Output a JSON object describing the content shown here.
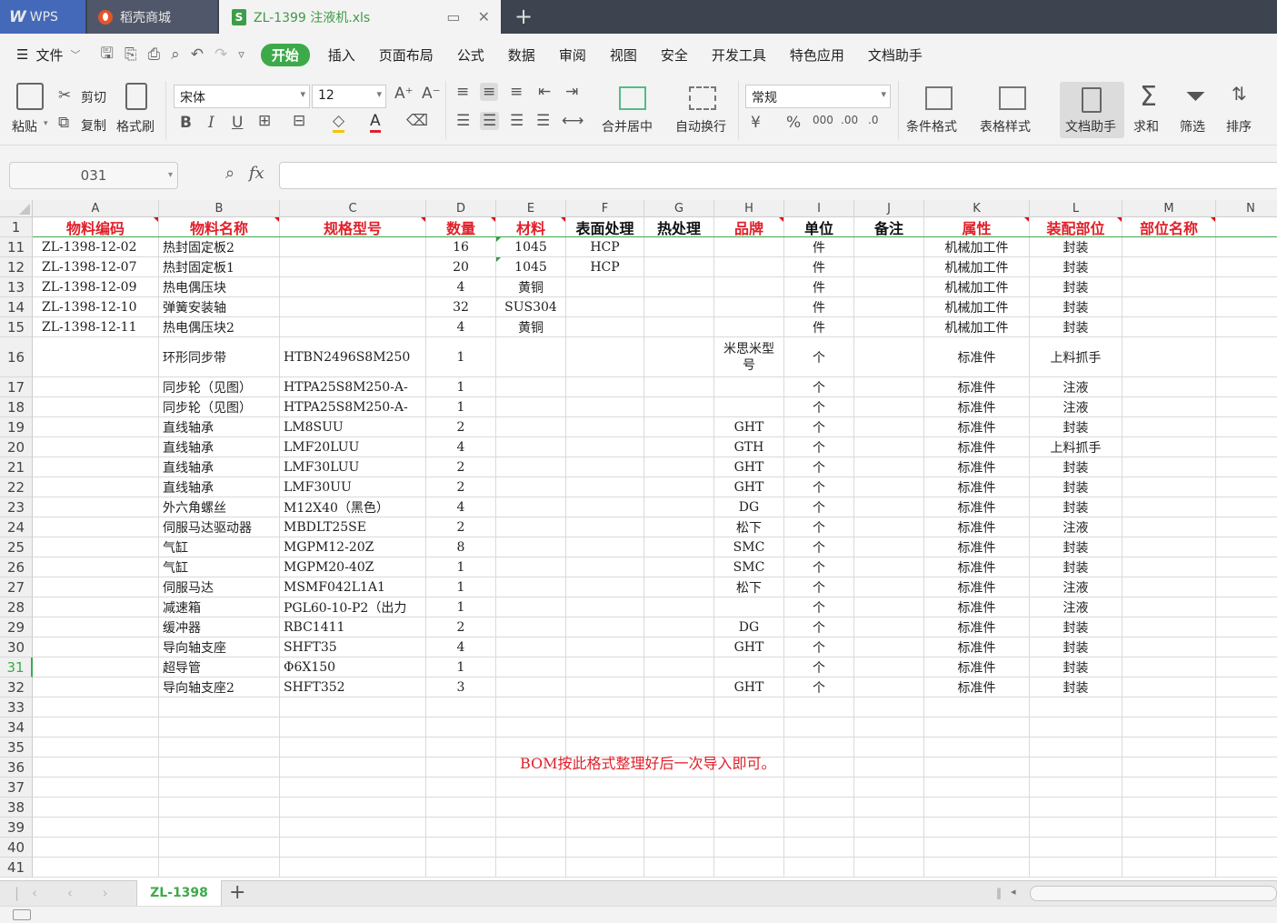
{
  "titlebar": {
    "wps_label": "WPS",
    "store_label": "稻壳商城",
    "file_title": "ZL-1399 注液机.xls",
    "file_icon_letter": "S",
    "new_tab": "+"
  },
  "menubar": {
    "file_menu": "文件",
    "items": [
      "开始",
      "插入",
      "页面布局",
      "公式",
      "数据",
      "审阅",
      "视图",
      "安全",
      "开发工具",
      "特色应用",
      "文档助手"
    ],
    "active": "开始"
  },
  "ribbon": {
    "paste": "粘贴",
    "cut": "剪切",
    "copy": "复制",
    "format_painter": "格式刷",
    "font_name": "宋体",
    "font_size": "12",
    "merge_center": "合并居中",
    "auto_wrap": "自动换行",
    "number_format": "常规",
    "conditional_format": "条件格式",
    "table_style": "表格样式",
    "doc_assistant": "文档助手",
    "sum": "求和",
    "filter": "筛选",
    "sort": "排序"
  },
  "formula_bar": {
    "name_box": "031",
    "fx": "fx",
    "content": ""
  },
  "columns": [
    "A",
    "B",
    "C",
    "D",
    "E",
    "F",
    "G",
    "H",
    "I",
    "J",
    "K",
    "L",
    "M",
    "N"
  ],
  "header_row": {
    "row_num": "1",
    "cells": [
      "物料编码",
      "物料名称",
      "规格型号",
      "数量",
      "材料",
      "表面处理",
      "热处理",
      "品牌",
      "单位",
      "备注",
      "属性",
      "装配部位",
      "部位名称",
      ""
    ]
  },
  "rows": [
    {
      "num": "11",
      "cells": [
        "ZL-1398-12-02",
        "热封固定板2",
        "",
        "16",
        "1045",
        "HCP",
        "",
        "",
        "件",
        "",
        "机械加工件",
        "封装",
        ""
      ]
    },
    {
      "num": "12",
      "cells": [
        "ZL-1398-12-07",
        "热封固定板1",
        "",
        "20",
        "1045",
        "HCP",
        "",
        "",
        "件",
        "",
        "机械加工件",
        "封装",
        ""
      ]
    },
    {
      "num": "13",
      "cells": [
        "ZL-1398-12-09",
        "热电偶压块",
        "",
        "4",
        "黄铜",
        "",
        "",
        "",
        "件",
        "",
        "机械加工件",
        "封装",
        ""
      ]
    },
    {
      "num": "14",
      "cells": [
        "ZL-1398-12-10",
        "弹簧安装轴",
        "",
        "32",
        "SUS304",
        "",
        "",
        "",
        "件",
        "",
        "机械加工件",
        "封装",
        ""
      ]
    },
    {
      "num": "15",
      "cells": [
        "ZL-1398-12-11",
        "热电偶压块2",
        "",
        "4",
        "黄铜",
        "",
        "",
        "",
        "件",
        "",
        "机械加工件",
        "封装",
        ""
      ]
    },
    {
      "num": "16",
      "cells": [
        "",
        "环形同步带",
        "HTBN2496S8M250",
        "1",
        "",
        "",
        "",
        "米思米型号",
        "个",
        "",
        "标准件",
        "上料抓手",
        ""
      ]
    },
    {
      "num": "17",
      "cells": [
        "",
        "同步轮（见图）",
        "HTPA25S8M250-A-",
        "1",
        "",
        "",
        "",
        "",
        "个",
        "",
        "标准件",
        "注液",
        ""
      ]
    },
    {
      "num": "18",
      "cells": [
        "",
        "同步轮（见图）",
        "HTPA25S8M250-A-",
        "1",
        "",
        "",
        "",
        "",
        "个",
        "",
        "标准件",
        "注液",
        ""
      ]
    },
    {
      "num": "19",
      "cells": [
        "",
        "直线轴承",
        "LM8SUU",
        "2",
        "",
        "",
        "",
        "GHT",
        "个",
        "",
        "标准件",
        "封装",
        ""
      ]
    },
    {
      "num": "20",
      "cells": [
        "",
        "直线轴承",
        "LMF20LUU",
        "4",
        "",
        "",
        "",
        "GTH",
        "个",
        "",
        "标准件",
        "上料抓手",
        ""
      ]
    },
    {
      "num": "21",
      "cells": [
        "",
        "直线轴承",
        "LMF30LUU",
        "2",
        "",
        "",
        "",
        "GHT",
        "个",
        "",
        "标准件",
        "封装",
        ""
      ]
    },
    {
      "num": "22",
      "cells": [
        "",
        "直线轴承",
        "LMF30UU",
        "2",
        "",
        "",
        "",
        "GHT",
        "个",
        "",
        "标准件",
        "封装",
        ""
      ]
    },
    {
      "num": "23",
      "cells": [
        "",
        "外六角螺丝",
        "M12X40（黑色）",
        "4",
        "",
        "",
        "",
        "DG",
        "个",
        "",
        "标准件",
        "封装",
        ""
      ]
    },
    {
      "num": "24",
      "cells": [
        "",
        "伺服马达驱动器",
        "MBDLT25SE",
        "2",
        "",
        "",
        "",
        "松下",
        "个",
        "",
        "标准件",
        "注液",
        ""
      ]
    },
    {
      "num": "25",
      "cells": [
        "",
        "气缸",
        "MGPM12-20Z",
        "8",
        "",
        "",
        "",
        "SMC",
        "个",
        "",
        "标准件",
        "封装",
        ""
      ]
    },
    {
      "num": "26",
      "cells": [
        "",
        "气缸",
        "MGPM20-40Z",
        "1",
        "",
        "",
        "",
        "SMC",
        "个",
        "",
        "标准件",
        "封装",
        ""
      ]
    },
    {
      "num": "27",
      "cells": [
        "",
        "伺服马达",
        "MSMF042L1A1",
        "1",
        "",
        "",
        "",
        "松下",
        "个",
        "",
        "标准件",
        "注液",
        ""
      ]
    },
    {
      "num": "28",
      "cells": [
        "",
        "减速箱",
        "PGL60-10-P2（出力",
        "1",
        "",
        "",
        "",
        "",
        "个",
        "",
        "标准件",
        "注液",
        ""
      ]
    },
    {
      "num": "29",
      "cells": [
        "",
        "缓冲器",
        "RBC1411",
        "2",
        "",
        "",
        "",
        "DG",
        "个",
        "",
        "标准件",
        "封装",
        ""
      ]
    },
    {
      "num": "30",
      "cells": [
        "",
        "导向轴支座",
        "SHFT35",
        "4",
        "",
        "",
        "",
        "GHT",
        "个",
        "",
        "标准件",
        "封装",
        ""
      ]
    },
    {
      "num": "31",
      "cells": [
        "",
        "超导管",
        "Φ6X150",
        "1",
        "",
        "",
        "",
        "",
        "个",
        "",
        "标准件",
        "封装",
        ""
      ]
    },
    {
      "num": "32",
      "cells": [
        "",
        "导向轴支座2",
        "SHFT352",
        "3",
        "",
        "",
        "",
        "GHT",
        "个",
        "",
        "标准件",
        "封装",
        ""
      ]
    },
    {
      "num": "33",
      "cells": []
    },
    {
      "num": "34",
      "cells": []
    },
    {
      "num": "35",
      "cells": []
    },
    {
      "num": "36",
      "cells": []
    },
    {
      "num": "37",
      "cells": []
    },
    {
      "num": "38",
      "cells": []
    },
    {
      "num": "39",
      "cells": []
    },
    {
      "num": "40",
      "cells": []
    },
    {
      "num": "41",
      "cells": []
    }
  ],
  "selected_row": "31",
  "note": "BOM按此格式整理好后一次导入即可。",
  "sheet_tab": "ZL-1398",
  "colors": {
    "accent_green": "#3daa4a",
    "header_red": "#e0202a",
    "title_bar": "#3d4450"
  }
}
